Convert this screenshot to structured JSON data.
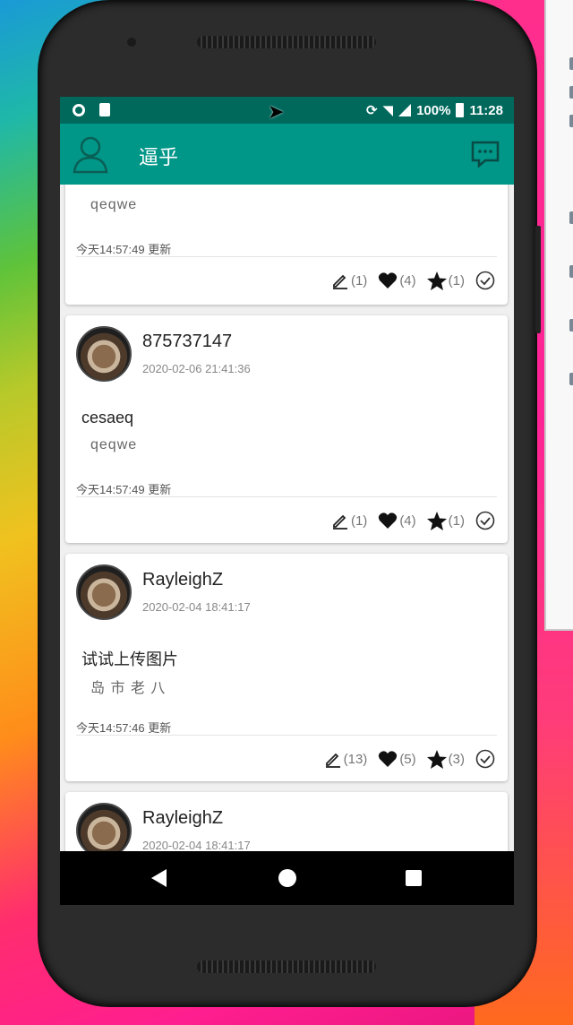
{
  "statusbar": {
    "battery": "100%",
    "time": "11:28"
  },
  "appbar": {
    "title": "逼乎"
  },
  "cards": [
    {
      "username": "",
      "date": "",
      "question": "",
      "body": "qeqwe",
      "updated": "今天14:57:49 更新",
      "comments": "(1)",
      "likes": "(4)",
      "stars": "(1)"
    },
    {
      "username": "875737147",
      "date": "2020-02-06 21:41:36",
      "question": "cesaeq",
      "body": "qeqwe",
      "updated": "今天14:57:49 更新",
      "comments": "(1)",
      "likes": "(4)",
      "stars": "(1)"
    },
    {
      "username": "RayleighZ",
      "date": "2020-02-04 18:41:17",
      "question": "试试上传图片",
      "body": "岛 市 老 八",
      "updated": "今天14:57:46 更新",
      "comments": "(13)",
      "likes": "(5)",
      "stars": "(3)"
    },
    {
      "username": "RayleighZ",
      "date": "2020-02-04 18:41:17"
    }
  ],
  "colors": {
    "statusbar": "#00695c",
    "appbar": "#009688"
  }
}
